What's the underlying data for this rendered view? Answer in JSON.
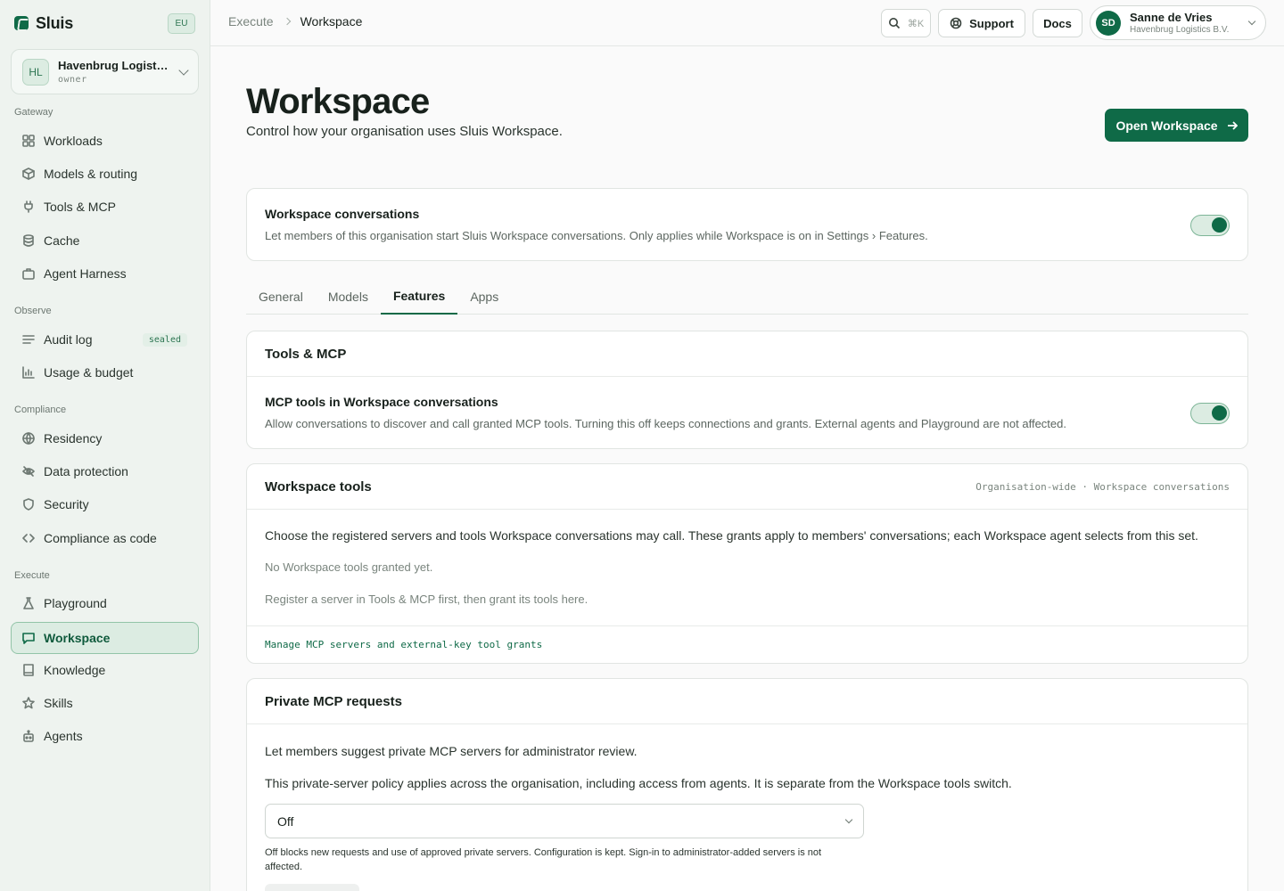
{
  "brand": {
    "name": "Sluis",
    "region": "EU"
  },
  "org": {
    "initials": "HL",
    "name": "Havenbrug Logistics B.V.",
    "role": "owner"
  },
  "nav": {
    "sections": [
      {
        "label": "Gateway"
      },
      {
        "label": "Observe"
      },
      {
        "label": "Compliance"
      },
      {
        "label": "Execute"
      }
    ],
    "items": [
      {
        "label": "Workloads",
        "icon": "grid-icon"
      },
      {
        "label": "Models & routing",
        "icon": "cube-icon"
      },
      {
        "label": "Tools & MCP",
        "icon": "plug-icon"
      },
      {
        "label": "Cache",
        "icon": "database-icon"
      },
      {
        "label": "Agent Harness",
        "icon": "briefcase-icon"
      },
      {
        "label": "Audit log",
        "icon": "list-icon",
        "badge": "sealed"
      },
      {
        "label": "Usage & budget",
        "icon": "bar-chart-icon"
      },
      {
        "label": "Residency",
        "icon": "globe-icon"
      },
      {
        "label": "Data protection",
        "icon": "eye-off-icon"
      },
      {
        "label": "Security",
        "icon": "shield-icon"
      },
      {
        "label": "Compliance as code",
        "icon": "code-icon"
      },
      {
        "label": "Playground",
        "icon": "flask-icon"
      },
      {
        "label": "Workspace",
        "icon": "chat-icon",
        "active": true
      },
      {
        "label": "Knowledge",
        "icon": "book-icon"
      },
      {
        "label": "Skills",
        "icon": "star-icon"
      },
      {
        "label": "Agents",
        "icon": "robot-icon"
      }
    ]
  },
  "topbar": {
    "breadcrumb": [
      "Execute",
      "Workspace"
    ],
    "search_shortcut": "⌘K",
    "support_label": "Support",
    "docs_label": "Docs",
    "user": {
      "initials": "SD",
      "name": "Sanne de Vries",
      "org": "Havenbrug Logistics B.V."
    }
  },
  "page": {
    "title": "Workspace",
    "subtitle": "Control how your organisation uses Sluis Workspace.",
    "open_button": "Open Workspace"
  },
  "conversations": {
    "title": "Workspace conversations",
    "description": "Let members of this organisation start Sluis Workspace conversations. Only applies while Workspace is on in Settings › Features.",
    "enabled": true
  },
  "tabs": [
    {
      "label": "General"
    },
    {
      "label": "Models"
    },
    {
      "label": "Features",
      "active": true
    },
    {
      "label": "Apps"
    }
  ],
  "tools_mcp": {
    "title": "Tools & MCP",
    "row_title": "MCP tools in Workspace conversations",
    "row_description": "Allow conversations to discover and call granted MCP tools. Turning this off keeps connections and grants. External agents and Playground are not affected.",
    "enabled": true
  },
  "workspace_tools": {
    "title": "Workspace tools",
    "meta": "Organisation-wide · Workspace conversations",
    "intro": "Choose the registered servers and tools Workspace conversations may call. These grants apply to members' conversations; each Workspace agent selects from this set.",
    "empty": "No Workspace tools granted yet.",
    "hint": "Register a server in Tools & MCP first, then grant its tools here.",
    "link": "Manage MCP servers and external-key tool grants"
  },
  "private_mcp": {
    "title": "Private MCP requests",
    "intro": "Let members suggest private MCP servers for administrator review.",
    "policy": "This private-server policy applies across the organisation, including access from agents. It is separate from the Workspace tools switch.",
    "select_value": "Off",
    "help": "Off blocks new requests and use of approved private servers. Configuration is kept. Sign-in to administrator-added servers is not affected."
  },
  "colors": {
    "accent": "#0f6a47",
    "accent_soft": "#dcece2",
    "sidebar_bg": "#eef3ef"
  }
}
